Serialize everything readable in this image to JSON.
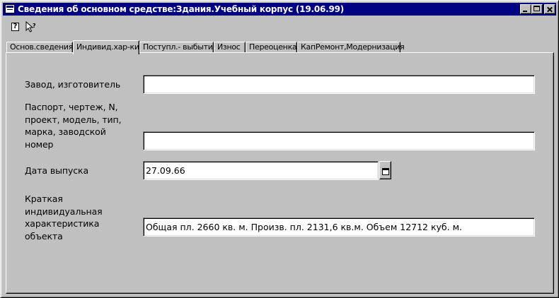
{
  "window": {
    "title": "Сведения об основном средстве:Здания.Учебный корпус (19.06.99)"
  },
  "toolbar": {
    "help_icon": "help-question-icon",
    "whats_this_icon": "whats-this-pointer-icon"
  },
  "tabs": [
    {
      "label": "Основ.сведения",
      "active": false
    },
    {
      "label": "Индивид.хар-ки",
      "active": true
    },
    {
      "label": "Поступл.- выбытие",
      "active": false
    },
    {
      "label": "Износ",
      "active": false
    },
    {
      "label": "Переоценка",
      "active": false
    },
    {
      "label": "КапРемонт,Модернизация",
      "active": false
    }
  ],
  "form": {
    "manufacturer": {
      "label": "Завод, изготовитель",
      "value": ""
    },
    "passport": {
      "label_lines": [
        "Паспорт, чертеж, N,",
        "проект, модель, тип,",
        "марка, заводской",
        "номер"
      ],
      "value": ""
    },
    "release_date": {
      "label": "Дата выпуска",
      "value": "27.09.66"
    },
    "description": {
      "label_lines": [
        "Краткая",
        "индивидуальная",
        "характеристика",
        "объекта"
      ],
      "value": "Общая пл. 2660 кв. м. Произв. пл. 2131,6 кв.м. Объем 12712 куб. м."
    }
  },
  "colors": {
    "titlebar": "#000080",
    "face": "#c0c0c0"
  }
}
